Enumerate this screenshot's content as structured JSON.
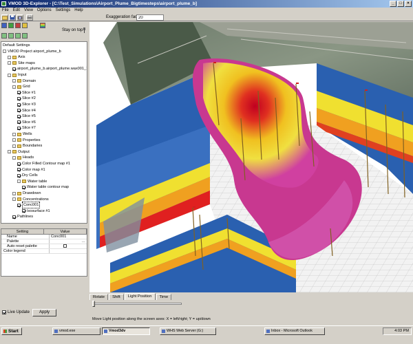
{
  "window": {
    "title": "VMOD 3D-Explorer - [C:\\Test_Simulations\\Airport_Plume_Bigtimesteps\\airport_plume_b]"
  },
  "menu": [
    "File",
    "Edit",
    "View",
    "Options",
    "Settings",
    "Help"
  ],
  "toolbar": {
    "exaggeration_label": "Exaggeration factor:",
    "exaggeration_value": "20"
  },
  "left_panel": {
    "stay_on_top": "Stay on top"
  },
  "tree": [
    {
      "label": "Default Settings",
      "depth": 0,
      "kind": "none"
    },
    {
      "label": "VMOD Project airport_plume_b",
      "depth": 0,
      "kind": "box"
    },
    {
      "label": "Axis",
      "depth": 1,
      "kind": "folder"
    },
    {
      "label": "Site maps",
      "depth": 1,
      "kind": "folder"
    },
    {
      "label": "airport_plume_b.airport_plume.wax001_1",
      "depth": 2,
      "kind": "check"
    },
    {
      "label": "Input",
      "depth": 1,
      "kind": "folder"
    },
    {
      "label": "Domain",
      "depth": 2,
      "kind": "folder"
    },
    {
      "label": "Grid",
      "depth": 2,
      "kind": "folder"
    },
    {
      "label": "Slice #1",
      "depth": 3,
      "kind": "check"
    },
    {
      "label": "Slice #2",
      "depth": 3,
      "kind": "check"
    },
    {
      "label": "Slice #3",
      "depth": 3,
      "kind": "check"
    },
    {
      "label": "Slice #4",
      "depth": 3,
      "kind": "check"
    },
    {
      "label": "Slice #5",
      "depth": 3,
      "kind": "check"
    },
    {
      "label": "Slice #6",
      "depth": 3,
      "kind": "check"
    },
    {
      "label": "Slice #7",
      "depth": 3,
      "kind": "check"
    },
    {
      "label": "Wells",
      "depth": 2,
      "kind": "folder"
    },
    {
      "label": "Properties",
      "depth": 2,
      "kind": "folder"
    },
    {
      "label": "Boundaries",
      "depth": 2,
      "kind": "folder"
    },
    {
      "label": "Output",
      "depth": 1,
      "kind": "folder"
    },
    {
      "label": "Heads",
      "depth": 2,
      "kind": "folder"
    },
    {
      "label": "Color Filled Contour map #1",
      "depth": 3,
      "kind": "check"
    },
    {
      "label": "Color map #1",
      "depth": 3,
      "kind": "check"
    },
    {
      "label": "Dry Cells",
      "depth": 3,
      "kind": "check"
    },
    {
      "label": "Water table",
      "depth": 3,
      "kind": "folder"
    },
    {
      "label": "Water table contour map",
      "depth": 4,
      "kind": "check"
    },
    {
      "label": "Drawdown",
      "depth": 2,
      "kind": "folder"
    },
    {
      "label": "Concentrations",
      "depth": 2,
      "kind": "folder"
    },
    {
      "label": "Conc001",
      "depth": 3,
      "kind": "check-selected"
    },
    {
      "label": "Isosurface #1",
      "depth": 4,
      "kind": "check"
    },
    {
      "label": "Pathlines",
      "depth": 2,
      "kind": "check"
    }
  ],
  "properties": {
    "col_setting": "Setting",
    "col_value": "Value",
    "rows": [
      {
        "key": "Name",
        "value": "Conc001"
      },
      {
        "key": "Palette",
        "value": ""
      },
      {
        "key": "Auto reset palette",
        "value": ""
      },
      {
        "key": "Color legend",
        "value": ""
      }
    ]
  },
  "live_update_label": "Live Update",
  "apply_label": "Apply",
  "view_tabs": [
    "Rotate",
    "Shift",
    "Light Position",
    "Time"
  ],
  "active_tab": "Light Position",
  "hint": "Move Light position along the screen axes: X = left/right; Y = up/down",
  "taskbar": {
    "start": "Start",
    "tasks": [
      {
        "label": "vmod.exe",
        "active": false
      },
      {
        "label": "Vmod3dv",
        "active": true
      },
      {
        "label": "WHS Web Server (G:)",
        "active": false
      },
      {
        "label": "Inbox - Microsoft Outlook",
        "active": false
      }
    ],
    "clock": "4:03 PM"
  }
}
